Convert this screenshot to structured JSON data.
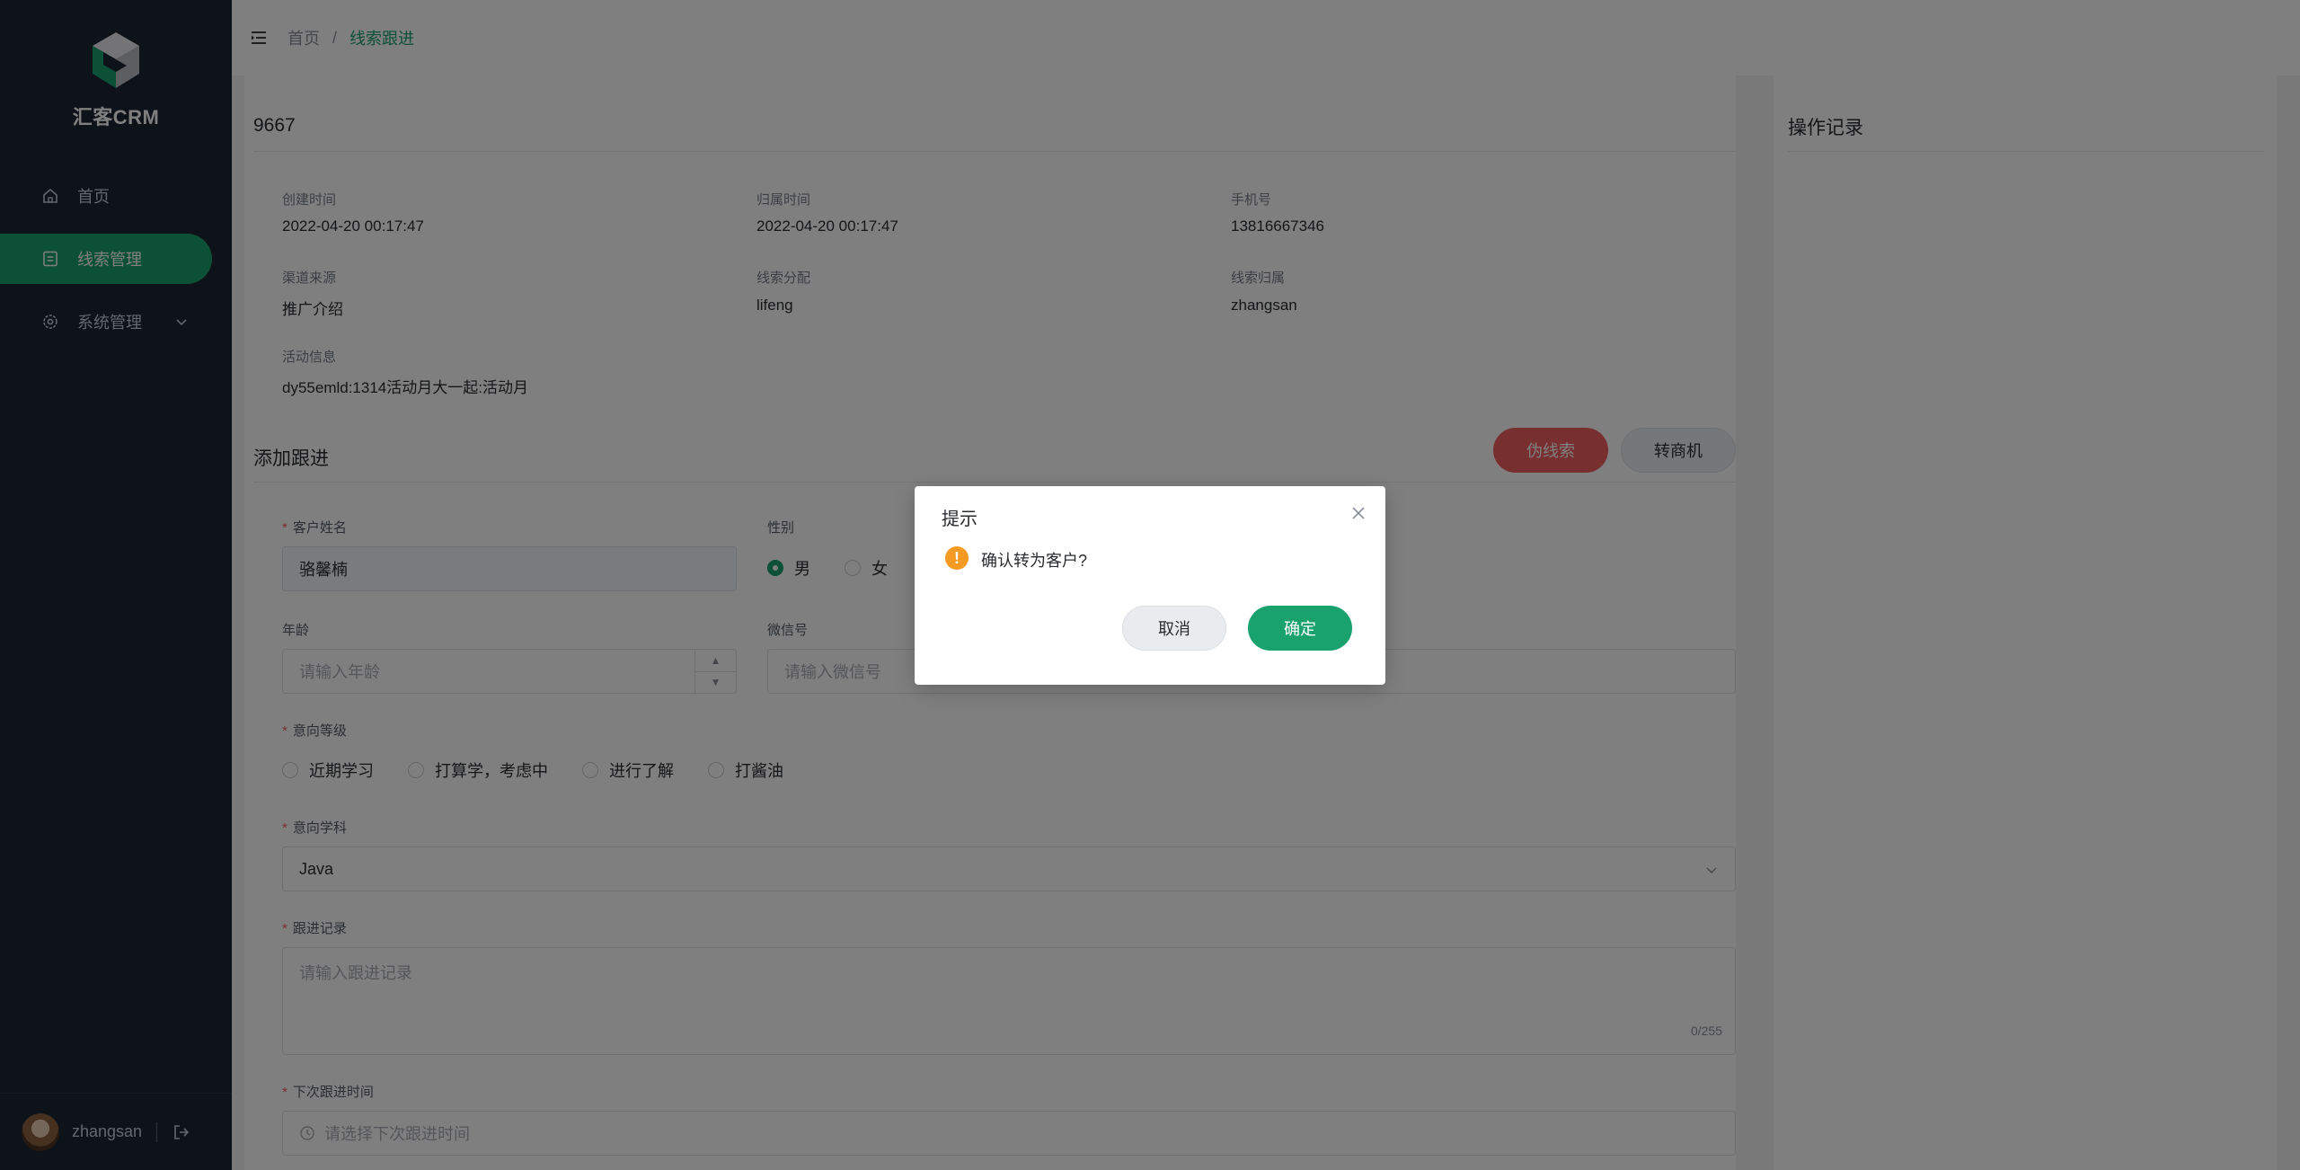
{
  "app": {
    "name": "汇客CRM"
  },
  "sidebar": {
    "items": [
      {
        "label": "首页",
        "icon": "home-icon"
      },
      {
        "label": "线索管理",
        "icon": "clipboard-icon",
        "active": true
      },
      {
        "label": "系统管理",
        "icon": "gear-icon",
        "expandable": true
      }
    ],
    "user": {
      "name": "zhangsan"
    }
  },
  "header": {
    "breadcrumb": {
      "home": "首页",
      "separator": "/",
      "current": "线索跟进"
    }
  },
  "clue": {
    "id": "9667",
    "fields": [
      {
        "label": "创建时间",
        "value": "2022-04-20 00:17:47"
      },
      {
        "label": "归属时间",
        "value": "2022-04-20 00:17:47"
      },
      {
        "label": "手机号",
        "value": "13816667346"
      },
      {
        "label": "渠道来源",
        "value": "推广介绍"
      },
      {
        "label": "线索分配",
        "value": "lifeng"
      },
      {
        "label": "线索归属",
        "value": "zhangsan"
      },
      {
        "label": "活动信息",
        "value": "dy55emld:1314活动月大一起:活动月"
      }
    ]
  },
  "followup": {
    "title": "添加跟进",
    "fake_button": "伪线索",
    "opportunity_button": "转商机",
    "name": {
      "label": "客户姓名",
      "value": "骆馨楠"
    },
    "gender": {
      "label": "性别",
      "options": [
        "男",
        "女"
      ],
      "selected": "男"
    },
    "age": {
      "label": "年龄",
      "placeholder": "请输入年龄"
    },
    "wechat": {
      "label": "微信号",
      "placeholder": "请输入微信号"
    },
    "intent_level": {
      "label": "意向等级",
      "options": [
        "近期学习",
        "打算学，考虑中",
        "进行了解",
        "打酱油"
      ]
    },
    "subject": {
      "label": "意向学科",
      "value": "Java"
    },
    "record": {
      "label": "跟进记录",
      "placeholder": "请输入跟进记录",
      "counter": "0/255"
    },
    "next_time": {
      "label": "下次跟进时间",
      "placeholder": "请选择下次跟进时间"
    }
  },
  "side_panel": {
    "title": "操作记录"
  },
  "dialog": {
    "title": "提示",
    "message": "确认转为客户?",
    "cancel": "取消",
    "confirm": "确定"
  },
  "colors": {
    "primary": "#19a16e",
    "danger": "#f05f5f",
    "warning": "#f59a23",
    "sidebar": "#1d2433"
  }
}
